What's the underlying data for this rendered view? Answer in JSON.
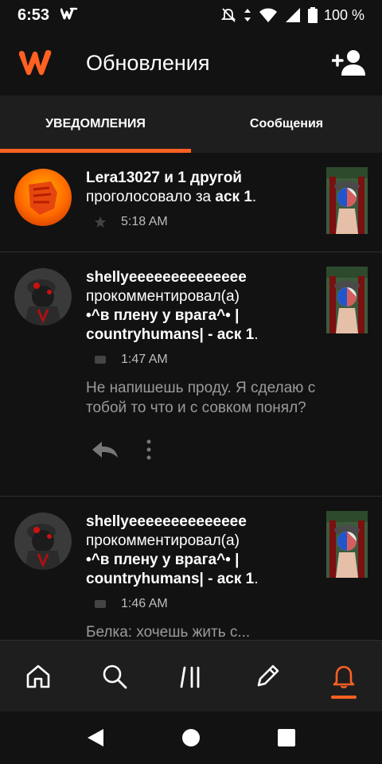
{
  "status_bar": {
    "time": "6:53",
    "battery": "100 %"
  },
  "header": {
    "title": "Обновления"
  },
  "tabs": [
    {
      "label": "УВЕДОМЛЕНИЯ",
      "active": true
    },
    {
      "label": "Сообщения",
      "active": false
    }
  ],
  "notifications": [
    {
      "actor": "Lera13027 и 1 другой",
      "action": "проголосовало за",
      "target": "аск 1",
      "time": "5:18 AM",
      "type": "vote"
    },
    {
      "actor": "shellyeeeeeeeeeeeeee",
      "action": "прокомментировал(а)",
      "target": "•^в плену у врага^• | countryhumans| - аск 1",
      "time": "1:47 AM",
      "comment": "Не напишешь проду. Я сделаю с тобой то что и с совком понял?",
      "type": "comment"
    },
    {
      "actor": "shellyeeeeeeeeeeeeee",
      "action": "прокомментировал(а)",
      "target": "•^в плену у врага^• | countryhumans| - аск 1",
      "time": "1:46 AM",
      "comment": "Белка: хочешь жить с...",
      "type": "comment"
    }
  ],
  "colors": {
    "accent": "#ff6122",
    "background": "#121212",
    "surface": "#1f1e1e"
  },
  "bottom_nav": [
    "home-icon",
    "search-icon",
    "library-icon",
    "write-icon",
    "bell-icon"
  ]
}
